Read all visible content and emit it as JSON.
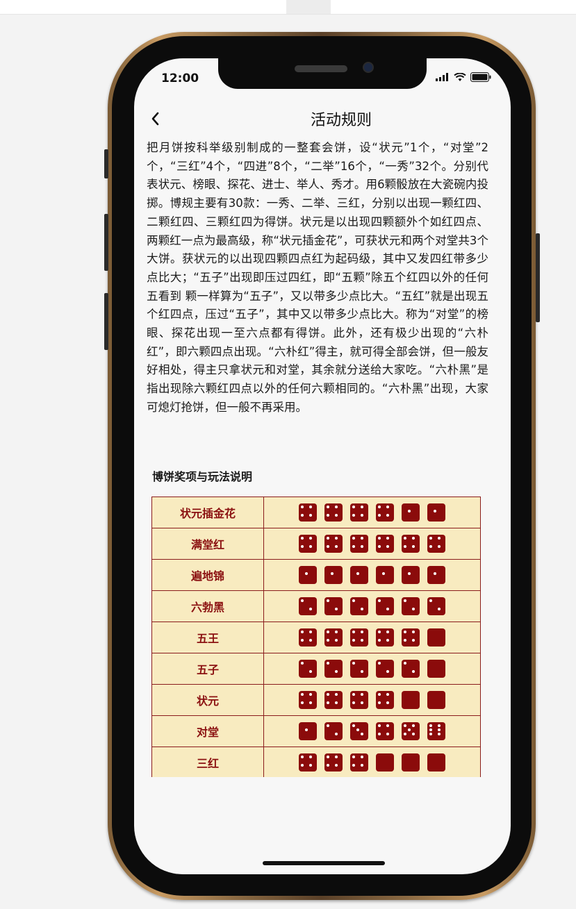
{
  "status": {
    "time": "12:00"
  },
  "nav": {
    "title": "活动规则"
  },
  "rules": {
    "text": "把月饼按科举级别制成的一整套会饼，设“状元”1个，“对堂”2个，“三红”4个，“四进”8个，“二举”16个，“一秀”32个。分别代表状元、榜眼、探花、进士、举人、秀才。用6颗骰放在大瓷碗内投掷。博规主要有30款：一秀、二举、三红，分别以出现一颗红四、二颗红四、三颗红四为得饼。状元是以出现四颗额外个如红四点、两颗红一点为最高级，称“状元插金花”，可获状元和两个对堂共3个大饼。获状元的以出现四颗四点红为起码级，其中又发四红带多少点比大；“五子”出现即压过四红，即“五颗”除五个红四以外的任何五看到 颗一样算为“五子”，又以带多少点比大。“五红”就是出现五个红四点，压过“五子”，其中又以带多少点比大。称为“对堂”的榜眼、探花出现一至六点都有得饼。此外，还有极少出现的“六朴红”，即六颗四点出现。“六朴红”得主，就可得全部会饼，但一般友好相处，得主只拿状元和对堂，其余就分送给大家吃。“六朴黑”是指出现除六颗红四点以外的任何六颗相同的。“六朴黑”出现，大家可熄灯抢饼，但一般不再采用。"
  },
  "prizes": {
    "section_title": "博饼奖项与玩法说明",
    "rows": [
      {
        "name": "状元插金花",
        "dice": [
          4,
          4,
          4,
          4,
          1,
          1
        ]
      },
      {
        "name": "满堂红",
        "dice": [
          4,
          4,
          4,
          4,
          4,
          4
        ]
      },
      {
        "name": "遍地锦",
        "dice": [
          1,
          1,
          1,
          1,
          1,
          1
        ]
      },
      {
        "name": "六勃黑",
        "dice": [
          2,
          2,
          2,
          2,
          2,
          2
        ]
      },
      {
        "name": "五王",
        "dice": [
          4,
          4,
          4,
          4,
          4,
          0
        ]
      },
      {
        "name": "五子",
        "dice": [
          2,
          2,
          2,
          2,
          2,
          0
        ]
      },
      {
        "name": "状元",
        "dice": [
          4,
          4,
          4,
          4,
          0,
          0
        ]
      },
      {
        "name": "对堂",
        "dice": [
          1,
          2,
          3,
          4,
          5,
          6
        ]
      },
      {
        "name": "三红",
        "dice": [
          4,
          4,
          4,
          0,
          0,
          0
        ]
      }
    ]
  },
  "colors": {
    "die": "#8b0b0b",
    "table_bg": "#f8ebc0",
    "table_border": "#8a1c1c",
    "name_text": "#8b1111"
  }
}
